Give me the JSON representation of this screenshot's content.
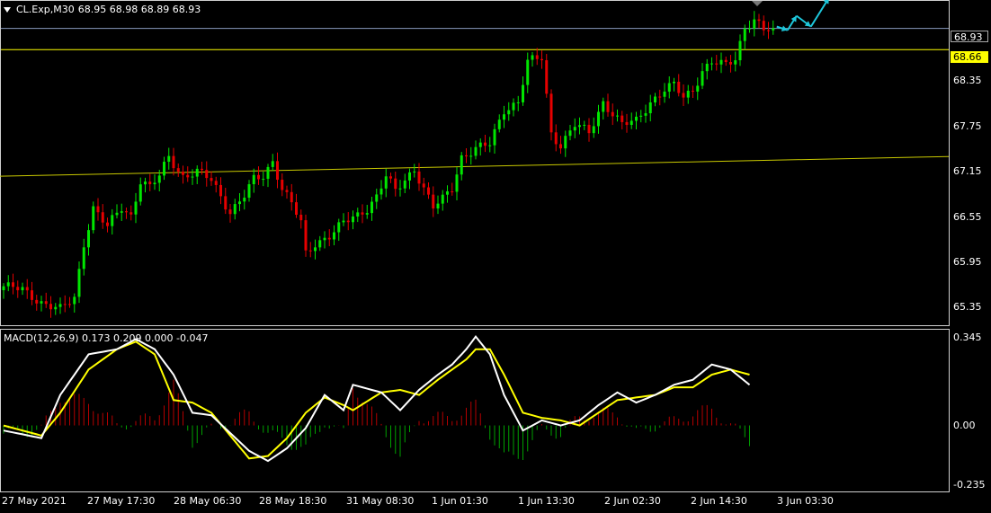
{
  "header": {
    "menu_icon": "triangle-down-icon",
    "symbol": "CL.Exp,M30",
    "ohlc": "68.95 68.98 68.89 68.93"
  },
  "price_axis": {
    "labels": [
      "68.35",
      "67.75",
      "67.15",
      "66.55",
      "65.95",
      "65.35"
    ],
    "current_price": "68.93",
    "level_price": "68.66"
  },
  "macd": {
    "label": "MACD(12,26,9) 0.173 0.209 0.000 -0.047",
    "axis_labels": [
      "0.345",
      "0.00",
      "-0.235"
    ]
  },
  "time_axis": {
    "labels": [
      "27 May 2021",
      "27 May 17:30",
      "28 May 06:30",
      "28 May 18:30",
      "31 May 08:30",
      "1 Jun 01:30",
      "1 Jun 13:30",
      "2 Jun 02:30",
      "2 Jun 14:30",
      "3 Jun 03:30"
    ]
  },
  "colors": {
    "background": "#000000",
    "bull": "#00e600",
    "bear": "#e60000",
    "level_line": "#ffff00",
    "trend_line": "#c8c800",
    "current_line": "#8899bb",
    "macd_line": "#ffffff",
    "signal_line": "#ffff00",
    "hist_pos": "#b40000",
    "hist_neg": "#00a000",
    "arrow": "#1ec8dc"
  },
  "chart_data": [
    {
      "type": "candlestick",
      "title": "CL.Exp,M30",
      "ylim": [
        65.2,
        69.2
      ],
      "ticks": [
        68.35,
        67.75,
        67.15,
        66.55,
        65.95,
        65.35
      ],
      "close_path": [
        [
          0,
          65.65
        ],
        [
          4,
          65.6
        ],
        [
          8,
          65.45
        ],
        [
          12,
          65.35
        ],
        [
          15,
          65.5
        ],
        [
          17,
          66.2
        ],
        [
          19,
          66.65
        ],
        [
          22,
          66.4
        ],
        [
          25,
          66.65
        ],
        [
          27,
          66.55
        ],
        [
          29,
          67.0
        ],
        [
          31,
          66.9
        ],
        [
          33,
          67.05
        ],
        [
          35,
          67.3
        ],
        [
          38,
          67.05
        ],
        [
          41,
          67.1
        ],
        [
          44,
          67.0
        ],
        [
          46,
          66.8
        ],
        [
          48,
          66.6
        ],
        [
          51,
          66.8
        ],
        [
          53,
          67.0
        ],
        [
          55,
          67.05
        ],
        [
          57,
          67.25
        ],
        [
          59,
          66.9
        ],
        [
          61,
          66.7
        ],
        [
          63,
          66.45
        ],
        [
          64,
          66.05
        ],
        [
          66,
          66.2
        ],
        [
          69,
          66.3
        ],
        [
          72,
          66.45
        ],
        [
          75,
          66.55
        ],
        [
          77,
          66.65
        ],
        [
          79,
          66.8
        ],
        [
          81,
          67.05
        ],
        [
          83,
          66.85
        ],
        [
          85,
          67.0
        ],
        [
          87,
          67.15
        ],
        [
          89,
          66.9
        ],
        [
          91,
          66.65
        ],
        [
          93,
          66.75
        ],
        [
          95,
          66.9
        ],
        [
          97,
          67.3
        ],
        [
          100,
          67.4
        ],
        [
          103,
          67.45
        ],
        [
          106,
          67.9
        ],
        [
          109,
          68.0
        ],
        [
          111,
          68.5
        ],
        [
          114,
          68.55
        ],
        [
          116,
          67.6
        ],
        [
          118,
          67.45
        ],
        [
          121,
          67.7
        ],
        [
          124,
          67.6
        ],
        [
          127,
          68.0
        ],
        [
          129,
          67.85
        ],
        [
          131,
          67.7
        ],
        [
          134,
          67.75
        ],
        [
          137,
          68.0
        ],
        [
          140,
          68.15
        ],
        [
          142,
          68.2
        ],
        [
          144,
          68.05
        ],
        [
          146,
          68.15
        ],
        [
          148,
          68.4
        ],
        [
          150,
          68.5
        ],
        [
          153,
          68.45
        ],
        [
          155,
          68.55
        ],
        [
          157,
          68.95
        ],
        [
          159,
          69.05
        ],
        [
          161,
          68.9
        ],
        [
          163,
          68.93
        ]
      ],
      "price_level_lines": [
        68.93,
        68.66
      ],
      "trendline": {
        "from": [
          0,
          67.05
        ],
        "to": [
          175,
          67.3
        ]
      },
      "projection_arrows": [
        "down",
        "up",
        "down",
        "up"
      ]
    },
    {
      "type": "macd",
      "title": "MACD(12,26,9)",
      "ylim": [
        -0.235,
        0.345
      ],
      "macd": [
        [
          0,
          -0.02
        ],
        [
          8,
          -0.05
        ],
        [
          12,
          0.12
        ],
        [
          18,
          0.28
        ],
        [
          24,
          0.3
        ],
        [
          28,
          0.34
        ],
        [
          32,
          0.3
        ],
        [
          36,
          0.2
        ],
        [
          40,
          0.05
        ],
        [
          44,
          0.04
        ],
        [
          48,
          -0.03
        ],
        [
          52,
          -0.1
        ],
        [
          56,
          -0.14
        ],
        [
          60,
          -0.09
        ],
        [
          64,
          -0.01
        ],
        [
          68,
          0.12
        ],
        [
          72,
          0.06
        ],
        [
          74,
          0.16
        ],
        [
          80,
          0.13
        ],
        [
          84,
          0.06
        ],
        [
          88,
          0.14
        ],
        [
          92,
          0.2
        ],
        [
          95,
          0.24
        ],
        [
          98,
          0.3
        ],
        [
          100,
          0.35
        ],
        [
          103,
          0.28
        ],
        [
          106,
          0.12
        ],
        [
          110,
          -0.02
        ],
        [
          114,
          0.02
        ],
        [
          118,
          0.0
        ],
        [
          122,
          0.02
        ],
        [
          126,
          0.08
        ],
        [
          130,
          0.13
        ],
        [
          134,
          0.09
        ],
        [
          138,
          0.12
        ],
        [
          142,
          0.16
        ],
        [
          146,
          0.18
        ],
        [
          150,
          0.24
        ],
        [
          154,
          0.22
        ],
        [
          158,
          0.16
        ]
      ],
      "signal": [
        [
          0,
          0.0
        ],
        [
          8,
          -0.04
        ],
        [
          12,
          0.05
        ],
        [
          18,
          0.22
        ],
        [
          24,
          0.3
        ],
        [
          28,
          0.33
        ],
        [
          32,
          0.28
        ],
        [
          36,
          0.1
        ],
        [
          40,
          0.09
        ],
        [
          44,
          0.05
        ],
        [
          48,
          -0.04
        ],
        [
          52,
          -0.13
        ],
        [
          56,
          -0.12
        ],
        [
          60,
          -0.05
        ],
        [
          64,
          0.05
        ],
        [
          68,
          0.11
        ],
        [
          72,
          0.08
        ],
        [
          74,
          0.06
        ],
        [
          80,
          0.13
        ],
        [
          84,
          0.14
        ],
        [
          88,
          0.12
        ],
        [
          92,
          0.18
        ],
        [
          95,
          0.22
        ],
        [
          98,
          0.26
        ],
        [
          100,
          0.3
        ],
        [
          103,
          0.3
        ],
        [
          106,
          0.2
        ],
        [
          110,
          0.05
        ],
        [
          114,
          0.03
        ],
        [
          118,
          0.02
        ],
        [
          122,
          0.0
        ],
        [
          126,
          0.05
        ],
        [
          130,
          0.1
        ],
        [
          134,
          0.11
        ],
        [
          138,
          0.12
        ],
        [
          142,
          0.15
        ],
        [
          146,
          0.15
        ],
        [
          150,
          0.2
        ],
        [
          154,
          0.22
        ],
        [
          158,
          0.2
        ]
      ]
    }
  ]
}
